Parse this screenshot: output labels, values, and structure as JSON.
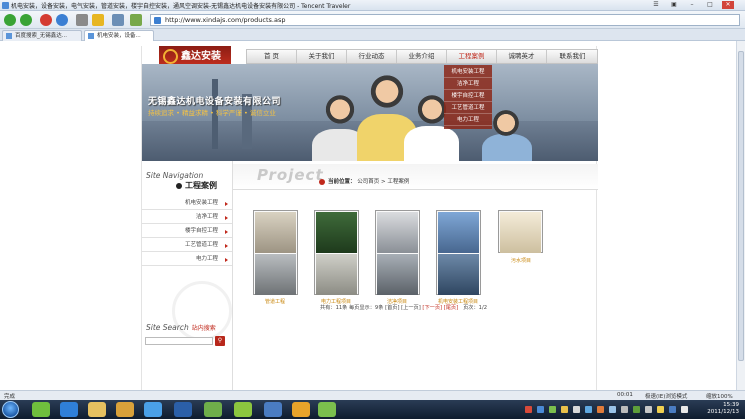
{
  "window": {
    "title": "机电安装，设备安装，电气安装，管道安装，楼宇自控安装，通风空调安装-无锡鑫达机电设备安装有限公司 - Tencent Traveler"
  },
  "browser": {
    "url": "http://www.xindajs.com/products.asp",
    "tabs": [
      {
        "label": "百度搜索_无锡鑫达..."
      },
      {
        "label": "机电安装，设备..."
      }
    ],
    "status_left": "完成",
    "status_time": "00:01",
    "status_mode": "极速(IE)浏览模式",
    "zoom": "缩放100%"
  },
  "site": {
    "logo_text": "鑫达安装",
    "menu": [
      {
        "label": "首 页"
      },
      {
        "label": "关于我们"
      },
      {
        "label": "行业动态"
      },
      {
        "label": "业务介绍"
      },
      {
        "label": "工程案例"
      },
      {
        "label": "诚聘英才"
      },
      {
        "label": "联系我们"
      }
    ],
    "submenu": [
      {
        "label": "机电安装工程"
      },
      {
        "label": "洁净工程"
      },
      {
        "label": "楼宇自控工程"
      },
      {
        "label": "工艺管道工程"
      },
      {
        "label": "电力工程"
      }
    ],
    "banner_title": "无锡鑫达机电设备安装有限公司",
    "banner_slogan": "持续追求 • 精益求精 • 科学严谨 • 诚信立业",
    "nav_title": "Site Navigation",
    "category_title": "工程案例",
    "side_items": [
      {
        "label": "机电安装工程"
      },
      {
        "label": "洁净工程"
      },
      {
        "label": "楼宇自控工程"
      },
      {
        "label": "工艺管道工程"
      },
      {
        "label": "电力工程"
      }
    ],
    "search_title": "Site Search",
    "search_sub": "站内搜索",
    "project_word": "Project",
    "breadcrumb": {
      "current": "当前位置：",
      "home": "公司首页",
      "sep": ">",
      "page": "工程案例"
    },
    "thumbs": [
      {
        "caption": "管道工程"
      },
      {
        "caption": "电力工程项目"
      },
      {
        "caption": "洁净项目"
      },
      {
        "caption": "机电安装工程项目"
      },
      {
        "caption": "污水项目"
      }
    ],
    "pager": {
      "info": "共有：11条  每页显示：9条  [首页]  [上一页]",
      "next": "[下一页]",
      "last": "[尾页]",
      "pages": "页次：1/2"
    }
  },
  "taskbar": {
    "time": "15:39",
    "date": "2011/12/13"
  }
}
